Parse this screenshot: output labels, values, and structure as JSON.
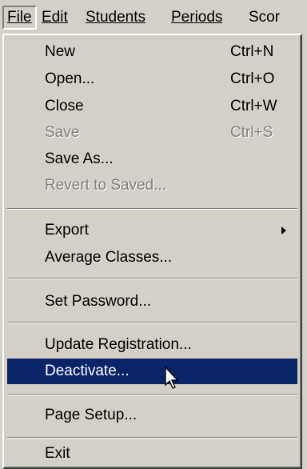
{
  "menubar": {
    "items": [
      {
        "label": "File"
      },
      {
        "label": "Edit"
      },
      {
        "label": "Students"
      },
      {
        "label": "Periods"
      },
      {
        "label": "Scor"
      }
    ]
  },
  "file_menu": {
    "new_label": "New",
    "new_shortcut": "Ctrl+N",
    "open_label": "Open...",
    "open_shortcut": "Ctrl+O",
    "close_label": "Close",
    "close_shortcut": "Ctrl+W",
    "save_label": "Save",
    "save_shortcut": "Ctrl+S",
    "save_as_label": "Save As...",
    "revert_label": "Revert to Saved...",
    "export_label": "Export",
    "average_classes_label": "Average Classes...",
    "set_password_label": "Set Password...",
    "update_registration_label": "Update Registration...",
    "deactivate_label": "Deactivate...",
    "page_setup_label": "Page Setup...",
    "exit_label": "Exit"
  },
  "icons": {
    "submenu_arrow": "chevron-right-icon",
    "pointer": "mouse-pointer-icon"
  },
  "colors": {
    "menu_bg": "#d4d0c8",
    "highlight_bg": "#0a246a",
    "highlight_text": "#ffffff",
    "disabled_text": "#808080"
  }
}
